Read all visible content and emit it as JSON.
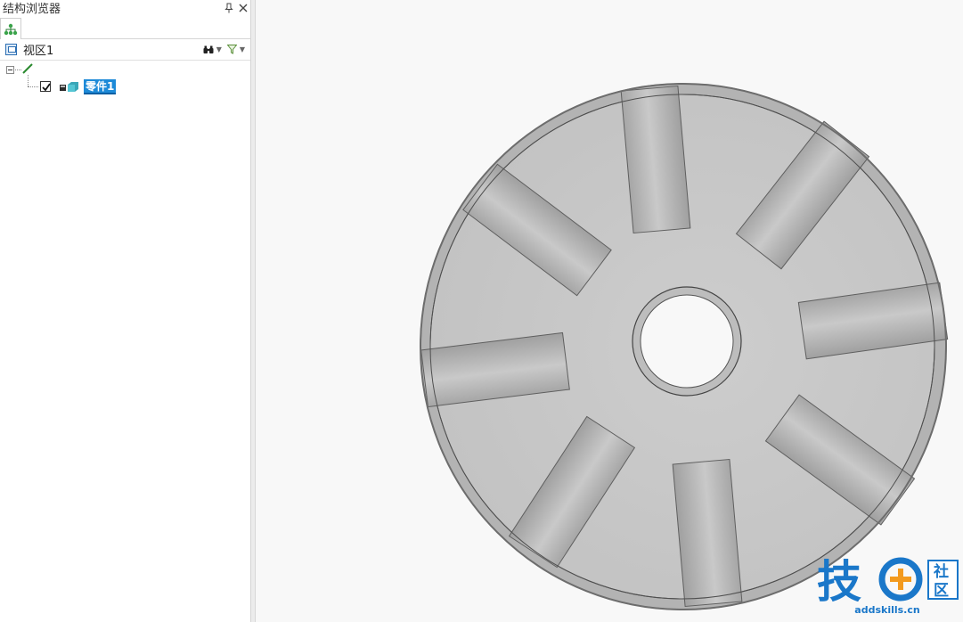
{
  "panel": {
    "title": "结构浏览器",
    "pin_icon": "pin-icon",
    "close_icon": "close-icon",
    "tab_icon": "structure-tree-icon",
    "view": {
      "label": "视区1",
      "icon": "viewport-icon",
      "find_icon": "binoculars-icon",
      "filter_icon": "filter-icon"
    },
    "tree": {
      "root_icon": "sketch-line-icon",
      "items": [
        {
          "label": "零件1",
          "checked": true,
          "icon": "part-icon",
          "selected": true
        }
      ]
    }
  },
  "viewport": {
    "model": "disk-with-radial-slots",
    "watermark": {
      "logo_text": "技",
      "badge_text_1": "社",
      "badge_text_2": "区",
      "domain": "addskills.cn",
      "color": "#1a77c9",
      "accent": "#f39a1e"
    }
  },
  "colors": {
    "selection": "#1d8ad8",
    "disk_face": "#c6c6c6",
    "disk_rim": "#a9a9a9",
    "slot": "#a3a3a3"
  }
}
